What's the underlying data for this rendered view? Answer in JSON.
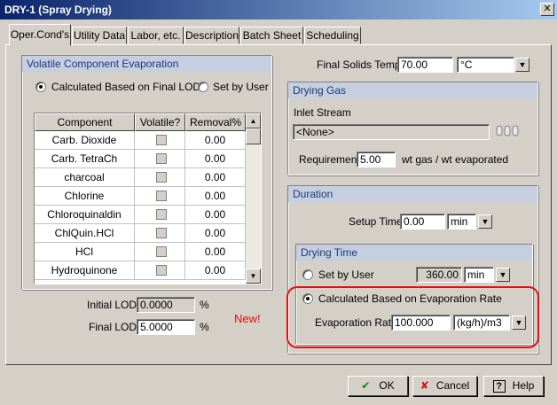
{
  "window": {
    "title": "DRY-1 (Spray Drying)",
    "close_glyph": "✕"
  },
  "tabs": [
    {
      "label": "Oper.Cond's"
    },
    {
      "label": "Utility Data"
    },
    {
      "label": "Labor, etc."
    },
    {
      "label": "Description"
    },
    {
      "label": "Batch Sheet"
    },
    {
      "label": "Scheduling"
    }
  ],
  "volatile": {
    "header": "Volatile Component Evaporation",
    "radio_calc": "Calculated Based on Final LOD",
    "radio_user": "Set by User",
    "selected": "calc",
    "columns": [
      "Component",
      "Volatile?",
      "Removal%"
    ],
    "rows": [
      {
        "component": "Carb. Dioxide",
        "removal": "0.00"
      },
      {
        "component": "Carb. TetraCh",
        "removal": "0.00"
      },
      {
        "component": "charcoal",
        "removal": "0.00"
      },
      {
        "component": "Chlorine",
        "removal": "0.00"
      },
      {
        "component": "Chloroquinaldin",
        "removal": "0.00"
      },
      {
        "component": "ChlQuin.HCl",
        "removal": "0.00"
      },
      {
        "component": "HCl",
        "removal": "0.00"
      },
      {
        "component": "Hydroquinone",
        "removal": "0.00"
      }
    ],
    "initial_lod_label": "Initial LOD",
    "initial_lod_value": "0.0000",
    "final_lod_label": "Final LOD",
    "final_lod_value": "5.0000",
    "percent": "%"
  },
  "final_solids": {
    "label": "Final Solids Temp.",
    "value": "70.00",
    "unit": "°C"
  },
  "drying_gas": {
    "header": "Drying Gas",
    "inlet_label": "Inlet Stream",
    "inlet_value": "<None>",
    "requirement_label": "Requirement",
    "requirement_value": "5.00",
    "requirement_unit": "wt gas / wt evaporated"
  },
  "duration": {
    "header": "Duration",
    "setup_label": "Setup Time",
    "setup_value": "0.00",
    "setup_unit": "min",
    "drying_time_header": "Drying Time",
    "radio_user": "Set by User",
    "user_value": "360.00",
    "user_unit": "min",
    "radio_calc": "Calculated Based on Evaporation Rate",
    "selected": "calc",
    "evap_label": "Evaporation Rate",
    "evap_value": "100.000",
    "evap_unit": "(kg/h)/m3"
  },
  "annotation": {
    "new_label": "New!",
    "color": "#e01010"
  },
  "buttons": {
    "ok": "OK",
    "cancel": "Cancel",
    "help": "Help"
  }
}
